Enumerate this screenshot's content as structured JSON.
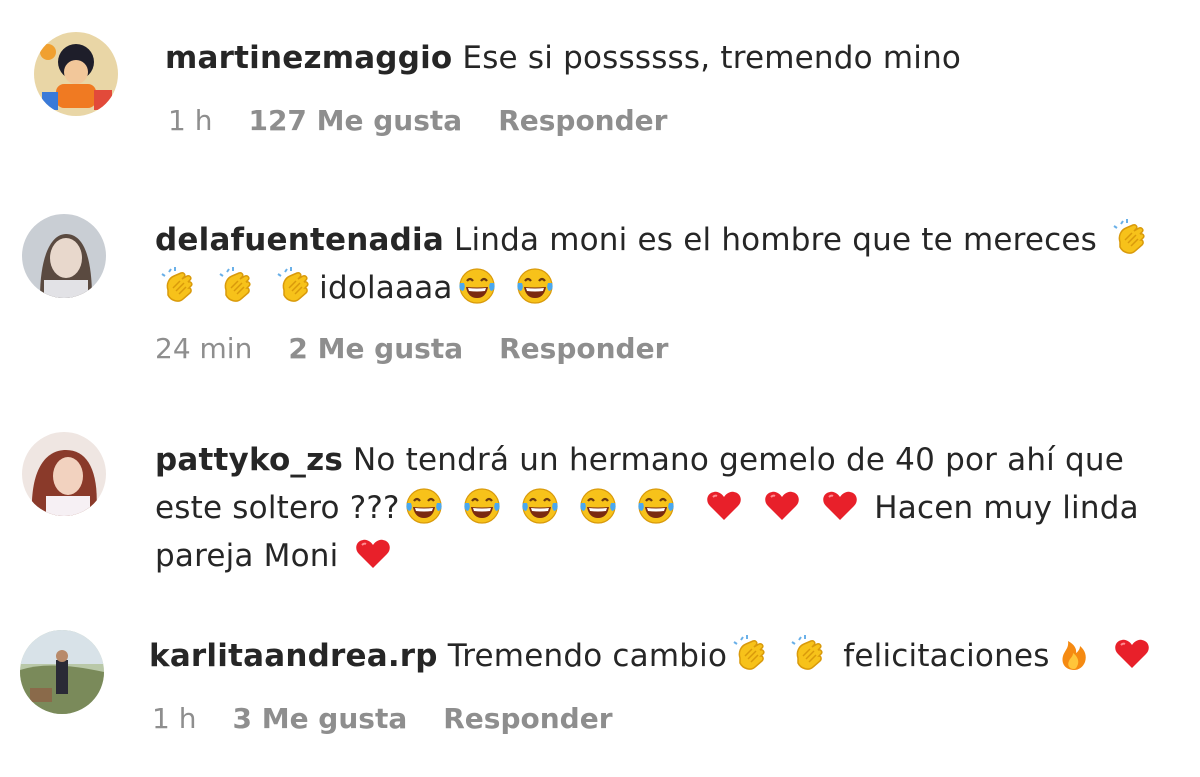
{
  "comments": [
    {
      "username": "martinezmaggio",
      "text": "Ese si possssss, tremendo mino",
      "time": "1 h",
      "likes": "127 Me gusta",
      "reply": "Responder"
    },
    {
      "username": "delafuentenadia",
      "text_a": "Linda moni es el hombre que te mereces",
      "text_b": "idolaaaa",
      "time": "24 min",
      "likes": "2 Me gusta",
      "reply": "Responder"
    },
    {
      "username": "pattyko_zs",
      "text_a": "No tendrá un hermano gemelo de 40 por ahí que",
      "text_b": "este soltero ???",
      "text_c": "Hacen muy linda",
      "text_d": "pareja Moni"
    },
    {
      "username": "karlitaandrea.rp",
      "text_a": "Tremendo cambio",
      "text_b": "felicitaciones",
      "time": "1 h",
      "likes": "3 Me gusta",
      "reply": "Responder"
    }
  ],
  "icons": {
    "clap": "clapping-hands-icon",
    "laugh": "tears-of-joy-icon",
    "heart": "red-heart-icon",
    "fire": "fire-icon"
  },
  "colors": {
    "text": "#262626",
    "meta": "#8e8e8e",
    "heart": "#e8202a",
    "emoji_yellow": "#f7c21a"
  }
}
